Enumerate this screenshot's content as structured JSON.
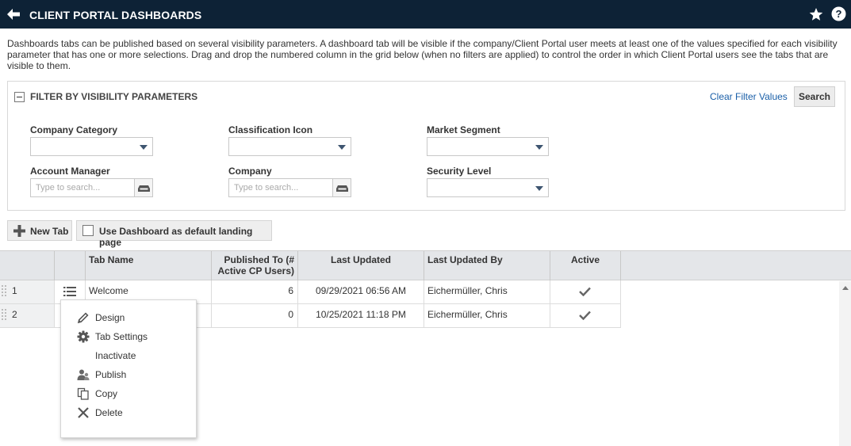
{
  "header": {
    "title": "CLIENT PORTAL DASHBOARDS"
  },
  "description": "Dashboards tabs can be published based on several visibility parameters. A dashboard tab will be visible if the company/Client Portal user meets at least one of the values specified for each visibility parameter that has one or more selections. Drag and drop the numbered column in the grid below (when no filters are applied) to control the order in which Client Portal users see the tabs that are visible to them.",
  "filter": {
    "title": "FILTER BY VISIBILITY PARAMETERS",
    "clear_label": "Clear Filter Values",
    "search_label": "Search",
    "company_category": {
      "label": "Company Category",
      "value": ""
    },
    "classification_icon": {
      "label": "Classification Icon",
      "value": ""
    },
    "market_segment": {
      "label": "Market Segment",
      "value": ""
    },
    "account_manager": {
      "label": "Account Manager",
      "placeholder": "Type to search..."
    },
    "company": {
      "label": "Company",
      "placeholder": "Type to search..."
    },
    "security_level": {
      "label": "Security Level",
      "value": ""
    }
  },
  "toolbar": {
    "new_tab_label": "New Tab",
    "default_landing_label": "Use Dashboard as default landing page",
    "default_landing_checked": false
  },
  "grid": {
    "headers": {
      "tab_name": "Tab Name",
      "published_to": "Published To (# Active CP Users)",
      "last_updated": "Last Updated",
      "last_updated_by": "Last Updated By",
      "active": "Active"
    },
    "rows": [
      {
        "num": "1",
        "tab_name": "Welcome",
        "published_to": "6",
        "last_updated": "09/29/2021 06:56 AM",
        "last_updated_by": "Eichermüller, Chris",
        "active": true
      },
      {
        "num": "2",
        "tab_name": "",
        "published_to": "0",
        "last_updated": "10/25/2021 11:18 PM",
        "last_updated_by": "Eichermüller, Chris",
        "active": true
      }
    ]
  },
  "context_menu": {
    "items": [
      {
        "label": "Design",
        "icon": "pencil-icon"
      },
      {
        "label": "Tab Settings",
        "icon": "gear-icon"
      },
      {
        "label": "Inactivate",
        "icon": ""
      },
      {
        "label": "Publish",
        "icon": "users-icon"
      },
      {
        "label": "Copy",
        "icon": "copy-icon"
      },
      {
        "label": "Delete",
        "icon": "close-icon"
      }
    ]
  },
  "colors": {
    "header_bg": "#0d2236",
    "link": "#1a5fa8",
    "grid_header_bg": "#e4e6e9"
  }
}
